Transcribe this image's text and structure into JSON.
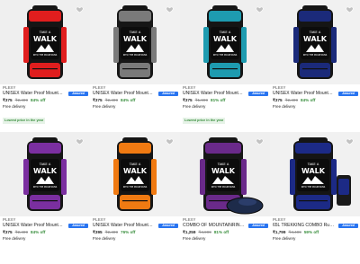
{
  "products": [
    {
      "brand": "PLEXY",
      "title": "UNISEX Water Proof Mountain Ru...",
      "price": "₹375",
      "mrp": "₹2,499",
      "off": "84% off",
      "delivery": "Free delivery",
      "tag": "Lowest price in the year",
      "assured": true,
      "accent": "#e01e1e",
      "main": "#151515"
    },
    {
      "brand": "PLEXY",
      "title": "UNISEX Water Proof Mountain H...",
      "price": "₹375",
      "mrp": "₹2,499",
      "off": "84% off",
      "delivery": "Free delivery",
      "tag": "",
      "assured": true,
      "accent": "#7a7a7a",
      "main": "#161616"
    },
    {
      "brand": "PLEXY",
      "title": "UNISEX Water Proof Mountain Ru...",
      "price": "₹375",
      "mrp": "₹1,999",
      "off": "81% off",
      "delivery": "Free delivery",
      "tag": "Lowest price in the year",
      "assured": true,
      "accent": "#1e9bb0",
      "main": "#151515"
    },
    {
      "brand": "PLEXY",
      "title": "UNISEX Water Proof Mountain Ru...",
      "price": "₹375",
      "mrp": "₹2,499",
      "off": "84% off",
      "delivery": "Free delivery",
      "tag": "",
      "assured": true,
      "accent": "#1b2a7a",
      "main": "#151515"
    },
    {
      "brand": "PLEXY",
      "title": "UNISEX Water Proof Mountain Ru...",
      "price": "₹375",
      "mrp": "₹2,499",
      "off": "84% off",
      "delivery": "Free delivery",
      "tag": "",
      "assured": true,
      "accent": "#7b2fa0",
      "main": "#151515"
    },
    {
      "brand": "PLEXY",
      "title": "UNISEX Water Proof Mountain Ru...",
      "price": "₹395",
      "mrp": "₹2,499",
      "off": "76% off",
      "delivery": "Free delivery",
      "tag": "",
      "assured": true,
      "accent": "#f07a12",
      "main": "#151515"
    },
    {
      "brand": "PLEXY",
      "title": "COMBO OF MOUNTAINRING RUC...",
      "price": "₹1,259",
      "mrp": "₹4,999",
      "off": "81% off",
      "delivery": "Free delivery",
      "tag": "",
      "assured": true,
      "accent": "#6a2a8a",
      "main": "#161616"
    },
    {
      "brand": "PLEXY",
      "title": "65L TREKKING COMBO Rucksack...",
      "price": "₹1,799",
      "mrp": "₹4,499",
      "off": "59% off",
      "delivery": "Free delivery",
      "tag": "",
      "assured": true,
      "accent": "#1c2a86",
      "main": "#151515"
    }
  ],
  "bag_logo": {
    "line1": "TAKE A",
    "line2": "WALK",
    "line3": "INTO THE MOUNTAINS"
  },
  "assured_label": "Assured",
  "icons": {
    "wishlist": "heart-icon"
  }
}
